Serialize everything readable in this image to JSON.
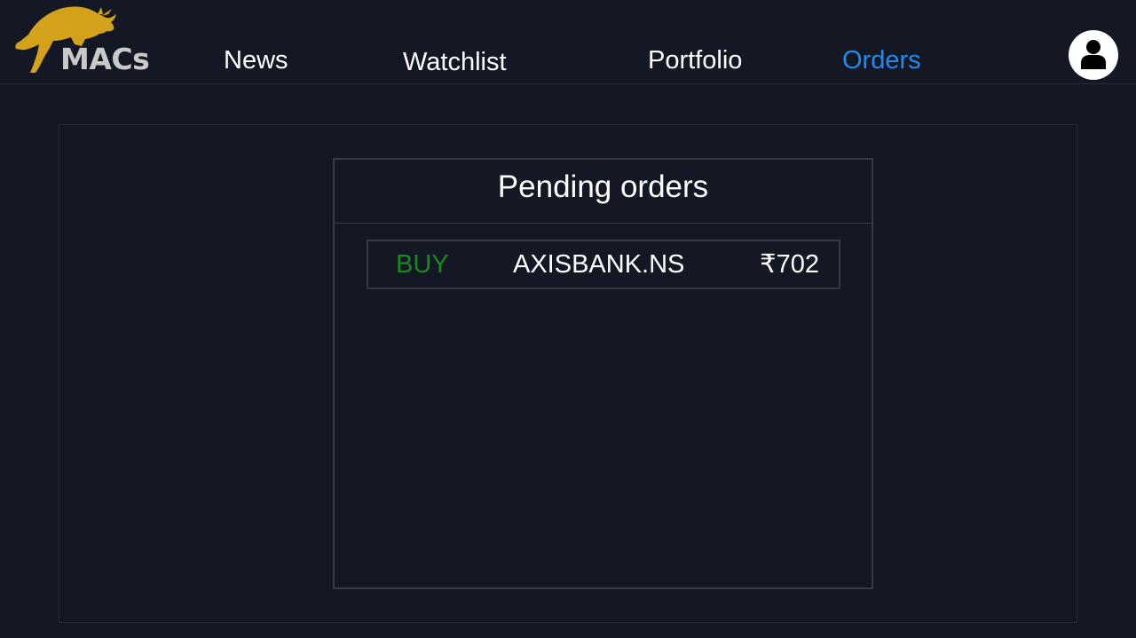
{
  "app": {
    "brand": "MACs",
    "brand_color": "#d4a21a"
  },
  "nav": {
    "items": [
      {
        "label": "News",
        "active": false
      },
      {
        "label": "Watchlist",
        "active": false
      },
      {
        "label": "Portfolio",
        "active": false
      },
      {
        "label": "Orders",
        "active": true
      }
    ],
    "active_color": "#1f8bf0",
    "profile_icon": "user-icon"
  },
  "orders": {
    "title": "Pending orders",
    "items": [
      {
        "side": "BUY",
        "symbol": "AXISBANK.NS",
        "price": "₹702",
        "side_color": "#188a1a"
      }
    ]
  },
  "colors": {
    "background": "#141824",
    "border": "#353a46"
  }
}
